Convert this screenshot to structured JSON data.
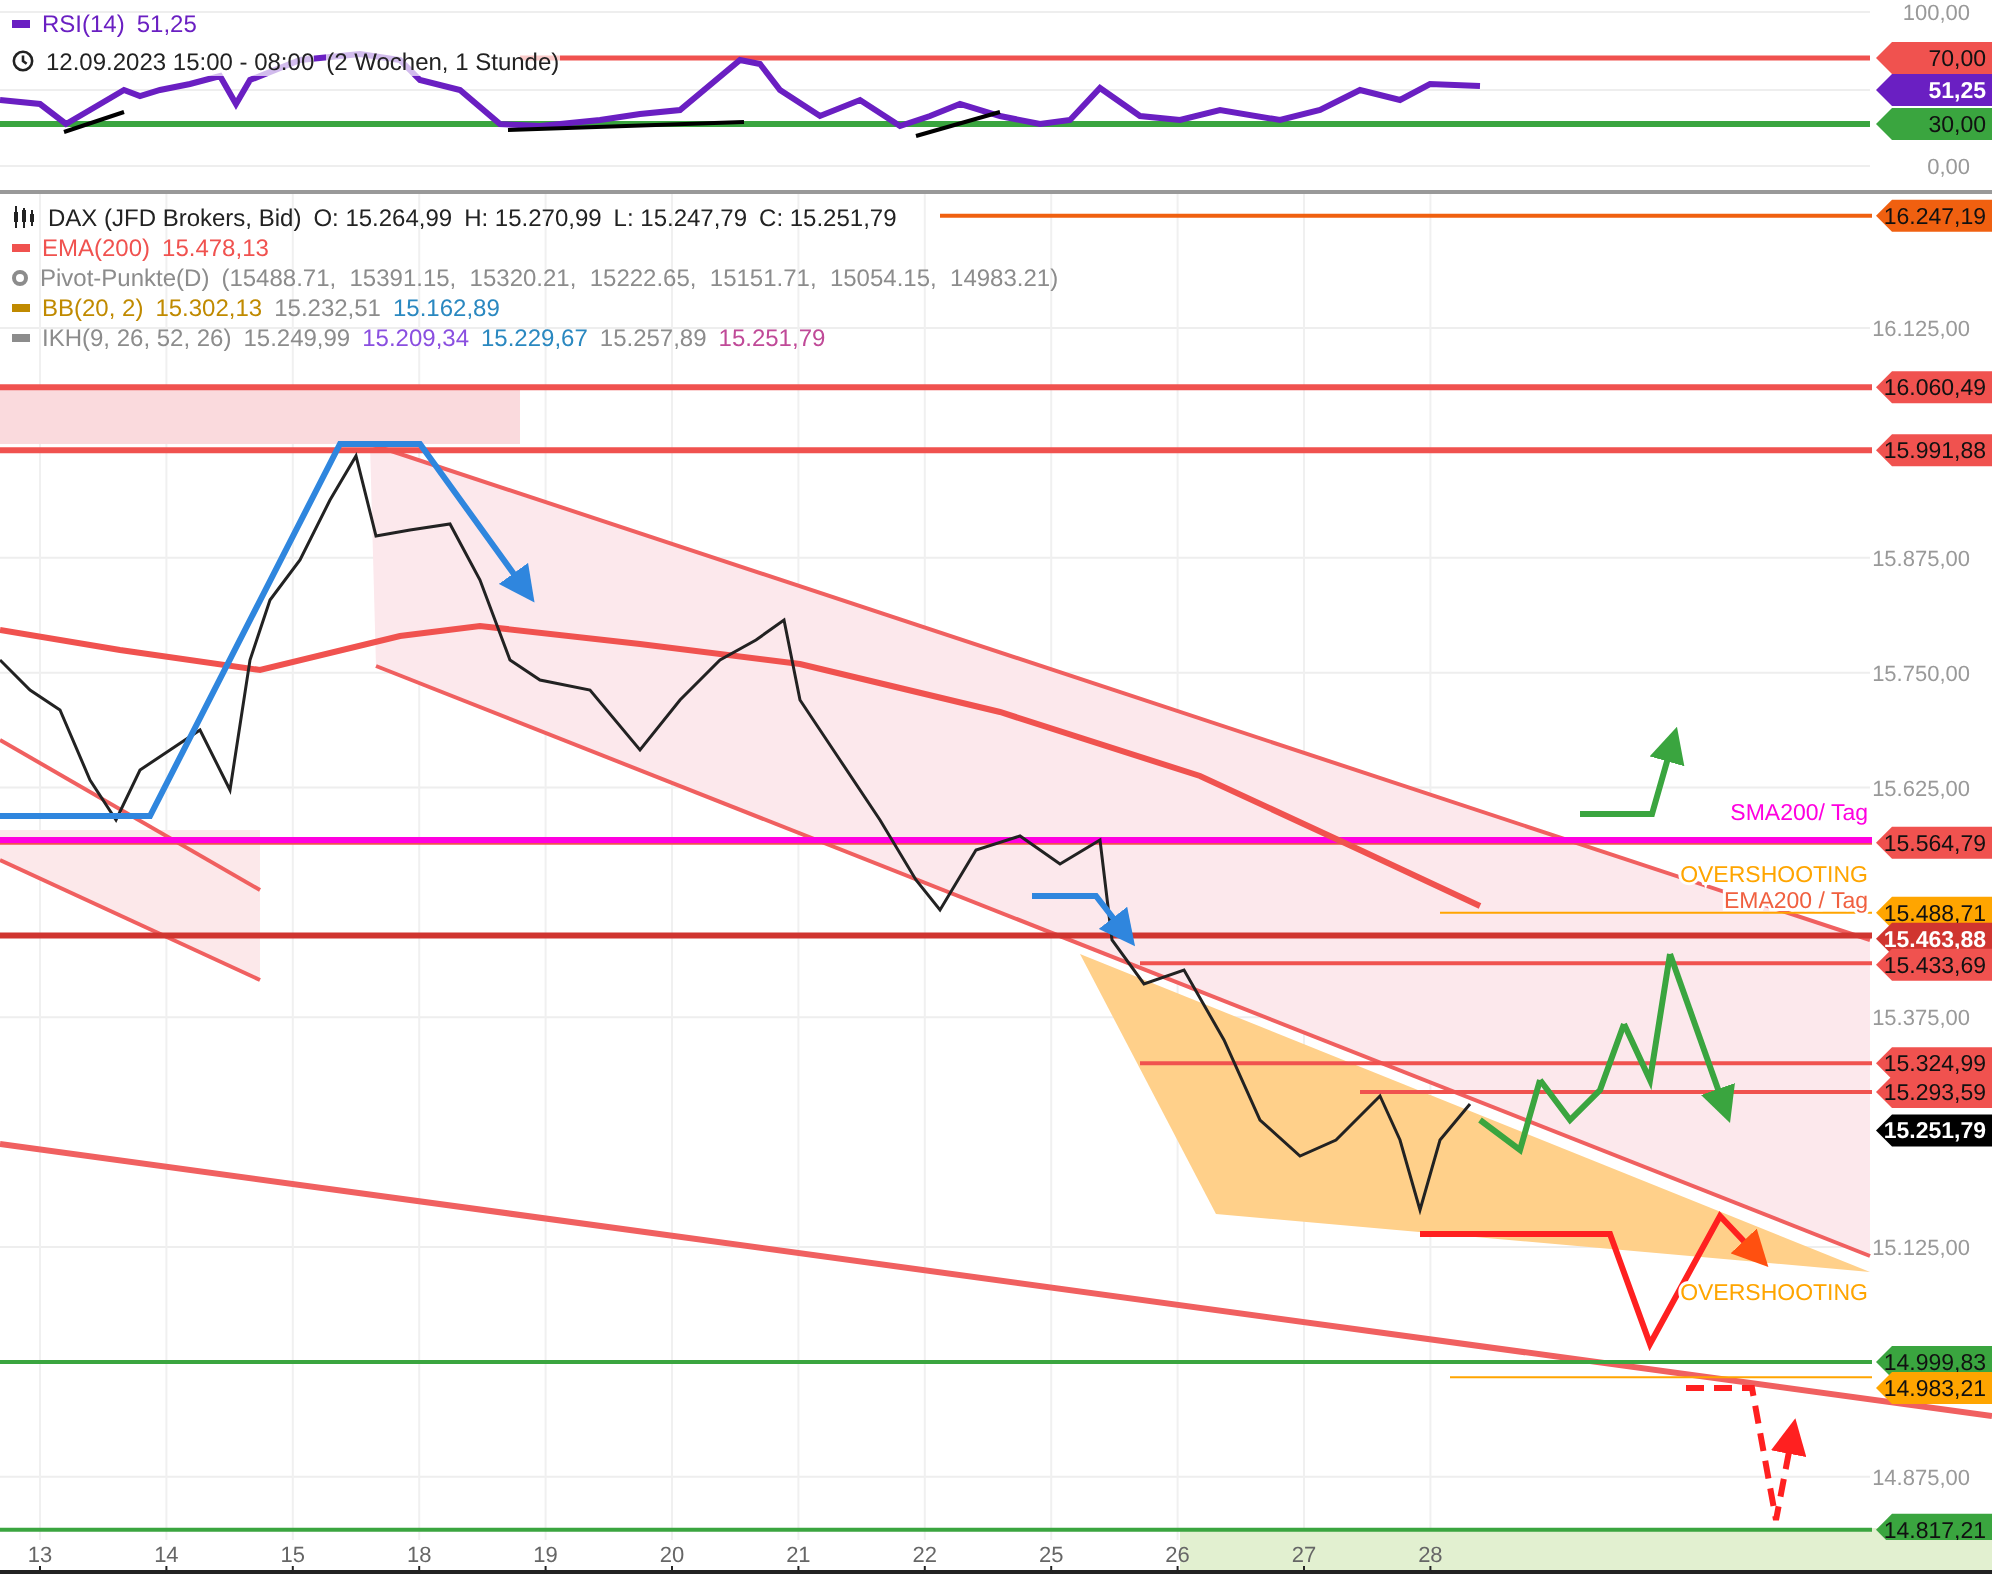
{
  "rsi_panel": {
    "legend": {
      "name": "RSI(14)",
      "value": "51,25",
      "color": "#6a1fc2"
    },
    "time": {
      "text": "12.09.2023 15:00 - 08:00",
      "range": "(2 Wochen, 1 Stunde)"
    },
    "y_ticks": [
      "100,00",
      "0,00"
    ],
    "tags": [
      {
        "label": "70,00",
        "color": "#f0524f"
      },
      {
        "label": "51,25",
        "color": "#6a1fc2"
      },
      {
        "label": "30,00",
        "color": "#3aa53f"
      }
    ]
  },
  "price_panel": {
    "legend": [
      {
        "kind": "instrument",
        "name": "DAX (JFD Brokers, Bid)",
        "values": [
          {
            "text": "O: 15.264,99",
            "color": "#222222"
          },
          {
            "text": "H: 15.270,99",
            "color": "#222222"
          },
          {
            "text": "L: 15.247,79",
            "color": "#222222"
          },
          {
            "text": "C: 15.251,79",
            "color": "#222222"
          }
        ]
      },
      {
        "kind": "line",
        "name": "EMA(200)",
        "color": "#f0524f",
        "values": [
          {
            "text": "15.478,13",
            "color": "#f0524f"
          }
        ]
      },
      {
        "kind": "dot",
        "name": "Pivot-Punkte(D)",
        "color": "#8c8c8c",
        "values": [
          {
            "text": "(15488.71,  15391.15,  15320.21,  15222.65,  15151.71,  15054.15,  14983.21)",
            "color": "#8c8c8c"
          }
        ]
      },
      {
        "kind": "line",
        "name": "BB(20, 2)",
        "color": "#c08a00",
        "values": [
          {
            "text": "15.302,13",
            "color": "#c08a00"
          },
          {
            "text": "15.232,51",
            "color": "#8c8c8c"
          },
          {
            "text": "15.162,89",
            "color": "#2a88c0"
          }
        ]
      },
      {
        "kind": "line",
        "name": "IKH(9, 26, 52, 26)",
        "color": "#8c8c8c",
        "values": [
          {
            "text": "15.249,99",
            "color": "#8c8c8c"
          },
          {
            "text": "15.209,34",
            "color": "#8a4fe0"
          },
          {
            "text": "15.229,67",
            "color": "#2a88c0"
          },
          {
            "text": "15.257,89",
            "color": "#8c8c8c"
          },
          {
            "text": "15.251,79",
            "color": "#c04a98"
          }
        ]
      }
    ],
    "y_ticks": [
      "16.125,00",
      "15.875,00",
      "15.750,00",
      "15.625,00",
      "15.375,00",
      "15.125,00",
      "14.875,00"
    ],
    "tags": [
      {
        "label": "16.247,19",
        "color": "#f06010"
      },
      {
        "label": "16.060,49",
        "color": "#f0524f"
      },
      {
        "label": "15.991,88",
        "color": "#f0524f"
      },
      {
        "label": "15.564,79",
        "color": "#f0524f"
      },
      {
        "label": "15.488,71",
        "color": "#ffa500"
      },
      {
        "label": "15.463,88",
        "color": "#d03530"
      },
      {
        "label": "15.433,69",
        "color": "#f0524f"
      },
      {
        "label": "15.324,99",
        "color": "#f0524f"
      },
      {
        "label": "15.293,59",
        "color": "#f0524f"
      },
      {
        "label": "15.251,79",
        "color": "#000000"
      },
      {
        "label": "14.999,83",
        "color": "#3aa53f"
      },
      {
        "label": "14.983,21",
        "color": "#ffa500"
      },
      {
        "label": "14.817,21",
        "color": "#3aa53f"
      }
    ],
    "line_labels": [
      {
        "text": "SMA200/ Tag",
        "color": "#ff00e0"
      },
      {
        "text": "OVERSHOOTING",
        "color": "#ffa500"
      },
      {
        "text": "EMA200 / Tag",
        "color": "#f06040"
      },
      {
        "text": "OVERSHOOTING",
        "color": "#ffa500"
      }
    ]
  },
  "x_axis": {
    "ticks": [
      "13",
      "14",
      "15",
      "18",
      "19",
      "20",
      "21",
      "22",
      "25",
      "26",
      "27",
      "28"
    ]
  }
}
